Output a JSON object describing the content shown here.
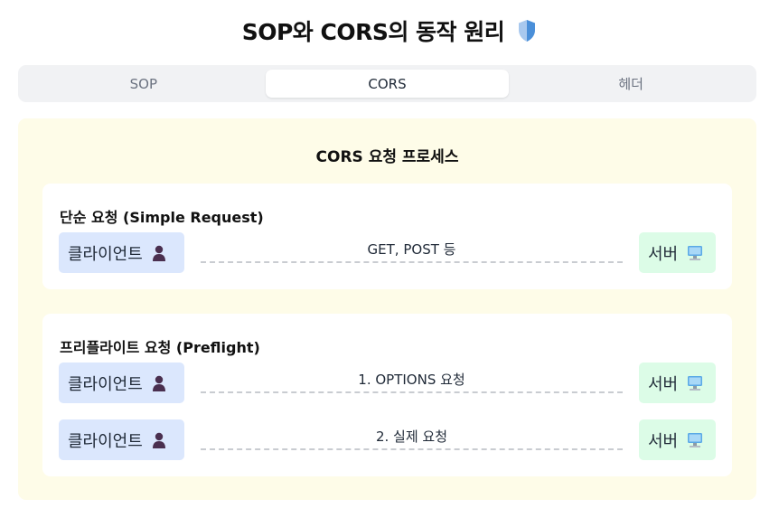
{
  "header": {
    "title": "SOP와 CORS의 동작 원리",
    "icon": "shield-icon"
  },
  "tabs": [
    {
      "label": "SOP",
      "active": false
    },
    {
      "label": "CORS",
      "active": true
    },
    {
      "label": "헤더",
      "active": false
    }
  ],
  "panel": {
    "title": "CORS 요청 프로세스",
    "simple": {
      "title": "단순 요청 (Simple Request)",
      "flows": [
        {
          "client": "클라이언트",
          "label": "GET, POST 등",
          "server": "서버"
        }
      ]
    },
    "preflight": {
      "title": "프리플라이트 요청 (Preflight)",
      "flows": [
        {
          "client": "클라이언트",
          "label": "1. OPTIONS 요청",
          "server": "서버"
        },
        {
          "client": "클라이언트",
          "label": "2. 실제 요청",
          "server": "서버"
        }
      ]
    }
  },
  "icons": {
    "client": "user-icon",
    "server": "computer-icon"
  },
  "colors": {
    "panel_bg": "#fefce8",
    "client_bg": "#dbe7fd",
    "server_bg": "#dcfce7",
    "tabs_bg": "#f1f2f4"
  }
}
